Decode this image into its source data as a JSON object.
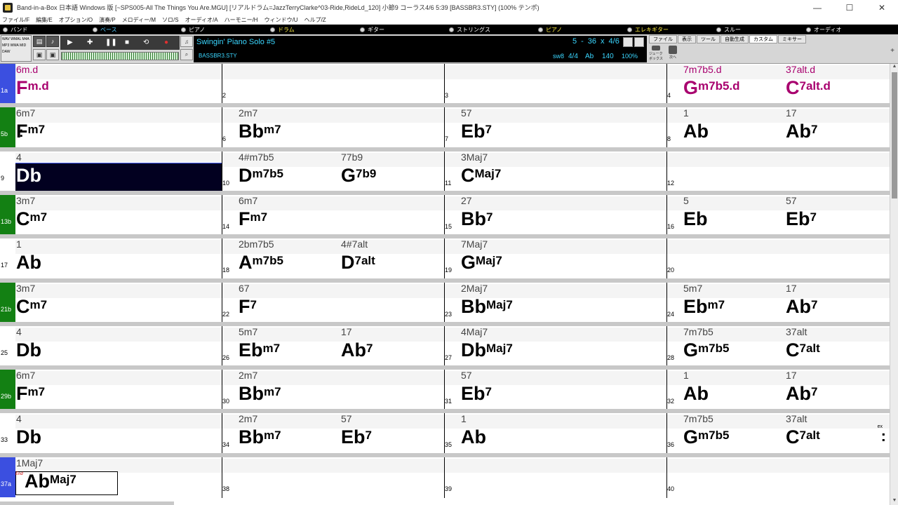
{
  "window": {
    "title": "Band-in-a-Box 日本語 Windows 版  [~SPS005-All The Things You Are.MGU] [リアルドラム=JazzTerryClarke^03-Ride,RideLd_120] 小節9 コーラス4/6   5:39  [BASSBR3.STY]  (100% テンポ)",
    "minimize": "—",
    "maximize": "☐",
    "close": "✕"
  },
  "menu": [
    "ファイル/F",
    "編集/E",
    "オプション/O",
    "演奏/P",
    "メロディー/M",
    "ソロ/S",
    "オーディオ/A",
    "ハーモニー/H",
    "ウィンドウ/U",
    "ヘルプ/Z"
  ],
  "tracks": [
    {
      "label": "バンド",
      "color": "#ffffff"
    },
    {
      "label": "ベース",
      "color": "#55ccff"
    },
    {
      "label": "ピアノ",
      "color": "#ffffff"
    },
    {
      "label": "ドラム",
      "color": "#ffee44"
    },
    {
      "label": "ギター",
      "color": "#ffffff"
    },
    {
      "label": "ストリングス",
      "color": "#ffffff"
    },
    {
      "label": "ピアノ",
      "color": "#ffee44"
    },
    {
      "label": "エレキギター",
      "color": "#ffee44"
    },
    {
      "label": "スルー",
      "color": "#ffffff"
    },
    {
      "label": "オーディオ",
      "color": "#ffffff"
    }
  ],
  "toolbar": {
    "formats": [
      "WAV",
      "WMAL",
      "M4A",
      "MP3",
      "WMA",
      "MID",
      "DAW"
    ],
    "style_title": "Swingin' Piano Solo #5",
    "style_file": "BASSBR3.STY",
    "position": [
      "5",
      "-",
      "36",
      "x",
      "4/6"
    ],
    "feel": "sw8",
    "time_sig": "4/4",
    "key": "Ab",
    "tempo": "140",
    "tempo_pct": "100%",
    "tabs": [
      "ファイル",
      "表示",
      "ツール",
      "自動生成",
      "カスタム",
      "ミキサー"
    ],
    "sub_icons": [
      "ジュークボックス",
      "次へ"
    ]
  },
  "colors": {
    "part_blue": "#3b4fe0",
    "part_green": "#138013",
    "magenta": "#a8006e"
  },
  "rows": [
    {
      "part": "1a",
      "color": "blue",
      "bars": [
        {
          "num": "",
          "chords": [
            {
              "small": "6m.d",
              "root": "F",
              "ext": "m.d",
              "magenta": true
            }
          ]
        },
        {
          "num": "2",
          "chords": []
        },
        {
          "num": "3",
          "chords": []
        },
        {
          "num": "4",
          "chords": [
            {
              "small": "7m7b5.d",
              "root": "G",
              "ext": "m7b5.d",
              "magenta": true
            },
            {
              "small": "37alt.d",
              "root": "C",
              "ext": "7alt.d",
              "magenta": true
            }
          ]
        }
      ]
    },
    {
      "part": "5b",
      "color": "green",
      "repeat": true,
      "bars": [
        {
          "num": "",
          "chords": [
            {
              "small": "6m7",
              "root": "F",
              "ext": "m7"
            }
          ]
        },
        {
          "num": "6",
          "chords": [
            {
              "small": "2m7",
              "root": "Bb",
              "ext": "m7"
            }
          ]
        },
        {
          "num": "7",
          "chords": [
            {
              "small": "57",
              "root": "Eb",
              "ext": "7"
            }
          ]
        },
        {
          "num": "8",
          "chords": [
            {
              "small": "1",
              "root": "Ab",
              "ext": ""
            },
            {
              "small": "17",
              "root": "Ab",
              "ext": "7"
            }
          ]
        }
      ]
    },
    {
      "part": "9",
      "color": "none",
      "highlight": true,
      "bars": [
        {
          "num": "",
          "chords": [
            {
              "small": "4",
              "root": "Db",
              "ext": ""
            }
          ]
        },
        {
          "num": "10",
          "chords": [
            {
              "small": "4#m7b5",
              "root": "D",
              "ext": "m7b5"
            },
            {
              "small": "77b9",
              "root": "G",
              "ext": "7b9"
            }
          ]
        },
        {
          "num": "11",
          "chords": [
            {
              "small": "3Maj7",
              "root": "C",
              "ext": "Maj7"
            }
          ]
        },
        {
          "num": "12",
          "chords": []
        }
      ]
    },
    {
      "part": "13b",
      "color": "green",
      "bars": [
        {
          "num": "",
          "chords": [
            {
              "small": "3m7",
              "root": "C",
              "ext": "m7"
            }
          ]
        },
        {
          "num": "14",
          "chords": [
            {
              "small": "6m7",
              "root": "F",
              "ext": "m7"
            }
          ]
        },
        {
          "num": "15",
          "chords": [
            {
              "small": "27",
              "root": "Bb",
              "ext": "7"
            }
          ]
        },
        {
          "num": "16",
          "chords": [
            {
              "small": "5",
              "root": "Eb",
              "ext": ""
            },
            {
              "small": "57",
              "root": "Eb",
              "ext": "7"
            }
          ]
        }
      ]
    },
    {
      "part": "17",
      "color": "none",
      "bars": [
        {
          "num": "",
          "chords": [
            {
              "small": "1",
              "root": "Ab",
              "ext": ""
            }
          ]
        },
        {
          "num": "18",
          "chords": [
            {
              "small": "2bm7b5",
              "root": "A",
              "ext": "m7b5"
            },
            {
              "small": "4#7alt",
              "root": "D",
              "ext": "7alt"
            }
          ]
        },
        {
          "num": "19",
          "chords": [
            {
              "small": "7Maj7",
              "root": "G",
              "ext": "Maj7"
            }
          ]
        },
        {
          "num": "20",
          "chords": []
        }
      ]
    },
    {
      "part": "21b",
      "color": "green",
      "bars": [
        {
          "num": "",
          "chords": [
            {
              "small": "3m7",
              "root": "C",
              "ext": "m7"
            }
          ]
        },
        {
          "num": "22",
          "chords": [
            {
              "small": "67",
              "root": "F",
              "ext": "7"
            }
          ]
        },
        {
          "num": "23",
          "chords": [
            {
              "small": "2Maj7",
              "root": "Bb",
              "ext": "Maj7"
            }
          ]
        },
        {
          "num": "24",
          "chords": [
            {
              "small": "5m7",
              "root": "Eb",
              "ext": "m7"
            },
            {
              "small": "17",
              "root": "Ab",
              "ext": "7"
            }
          ]
        }
      ]
    },
    {
      "part": "25",
      "color": "none",
      "bars": [
        {
          "num": "",
          "chords": [
            {
              "small": "4",
              "root": "Db",
              "ext": ""
            }
          ]
        },
        {
          "num": "26",
          "chords": [
            {
              "small": "5m7",
              "root": "Eb",
              "ext": "m7"
            },
            {
              "small": "17",
              "root": "Ab",
              "ext": "7"
            }
          ]
        },
        {
          "num": "27",
          "chords": [
            {
              "small": "4Maj7",
              "root": "Db",
              "ext": "Maj7"
            }
          ]
        },
        {
          "num": "28",
          "chords": [
            {
              "small": "7m7b5",
              "root": "G",
              "ext": "m7b5"
            },
            {
              "small": "37alt",
              "root": "C",
              "ext": "7alt"
            }
          ]
        }
      ]
    },
    {
      "part": "29b",
      "color": "green",
      "bars": [
        {
          "num": "",
          "chords": [
            {
              "small": "6m7",
              "root": "F",
              "ext": "m7"
            }
          ]
        },
        {
          "num": "30",
          "chords": [
            {
              "small": "2m7",
              "root": "Bb",
              "ext": "m7"
            }
          ]
        },
        {
          "num": "31",
          "chords": [
            {
              "small": "57",
              "root": "Eb",
              "ext": "7"
            }
          ]
        },
        {
          "num": "32",
          "chords": [
            {
              "small": "1",
              "root": "Ab",
              "ext": ""
            },
            {
              "small": "17",
              "root": "Ab",
              "ext": "7"
            }
          ]
        }
      ]
    },
    {
      "part": "33",
      "color": "none",
      "repeat_end": true,
      "bars": [
        {
          "num": "",
          "chords": [
            {
              "small": "4",
              "root": "Db",
              "ext": ""
            }
          ]
        },
        {
          "num": "34",
          "chords": [
            {
              "small": "2m7",
              "root": "Bb",
              "ext": "m7"
            },
            {
              "small": "57",
              "root": "Eb",
              "ext": "7"
            }
          ]
        },
        {
          "num": "35",
          "chords": [
            {
              "small": "1",
              "root": "Ab",
              "ext": ""
            }
          ]
        },
        {
          "num": "36",
          "chords": [
            {
              "small": "7m7b5",
              "root": "G",
              "ext": "m7b5"
            },
            {
              "small": "37alt",
              "root": "C",
              "ext": "7alt"
            }
          ]
        }
      ]
    },
    {
      "part": "37a",
      "color": "blue",
      "end": true,
      "bars": [
        {
          "num": "",
          "chords": [
            {
              "small": "1Maj7",
              "root": "Ab",
              "ext": "Maj7"
            }
          ]
        },
        {
          "num": "38",
          "chords": []
        },
        {
          "num": "39",
          "chords": []
        },
        {
          "num": "40",
          "chords": []
        }
      ]
    }
  ],
  "end_tag": "End",
  "repeat_tag": "ex"
}
